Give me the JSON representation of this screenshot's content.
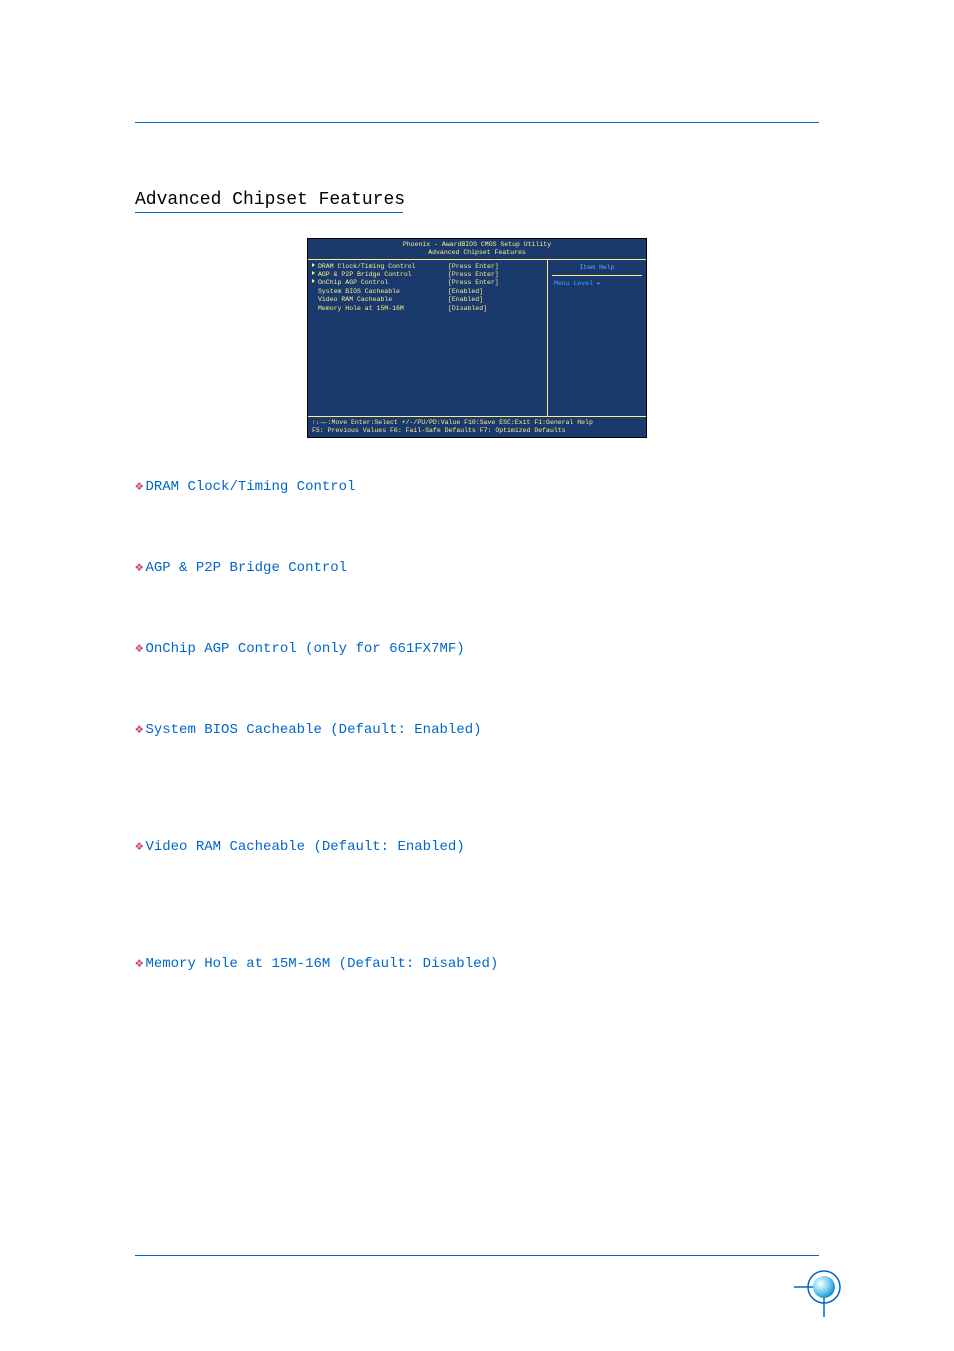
{
  "section_title": "Advanced Chipset Features",
  "bios": {
    "title_line1": "Phoenix - AwardBIOS CMOS Setup Utility",
    "title_line2": "Advanced Chipset Features",
    "items": [
      {
        "arrow": true,
        "label": "DRAM Clock/Timing Control",
        "value": "[Press Enter]"
      },
      {
        "arrow": true,
        "label": "AGP & P2P Bridge Control",
        "value": "[Press Enter]"
      },
      {
        "arrow": true,
        "label": "OnChip AGP Control",
        "value": "[Press Enter]"
      },
      {
        "arrow": false,
        "label": "System BIOS Cacheable",
        "value": "[Enabled]"
      },
      {
        "arrow": false,
        "label": "Video  RAM Cacheable",
        "value": "[Enabled]"
      },
      {
        "arrow": false,
        "label": "Memory Hole at 15M-16M",
        "value": "[Disabled]"
      }
    ],
    "right_header": "Item Help",
    "right_content": "Menu Level   ▸",
    "footer_line1": "↑↓→←:Move  Enter:Select  +/-/PU/PD:Value  F10:Save   ESC:Exit  F1:General Help",
    "footer_line2": "   F5: Previous Values    F6: Fail-Safe Defaults    F7: Optimized Defaults"
  },
  "features": [
    {
      "label": "DRAM Clock/Timing Control",
      "tall": false
    },
    {
      "label": "AGP & P2P Bridge Control",
      "tall": false
    },
    {
      "label": "OnChip AGP Control (only for 661FX7MF)",
      "tall": false
    },
    {
      "label": "System BIOS Cacheable (Default: Enabled)",
      "tall": true
    },
    {
      "label": "Video RAM Cacheable (Default: Enabled)",
      "tall": true
    },
    {
      "label": "Memory Hole at 15M-16M (Default: Disabled)",
      "tall": false
    }
  ]
}
